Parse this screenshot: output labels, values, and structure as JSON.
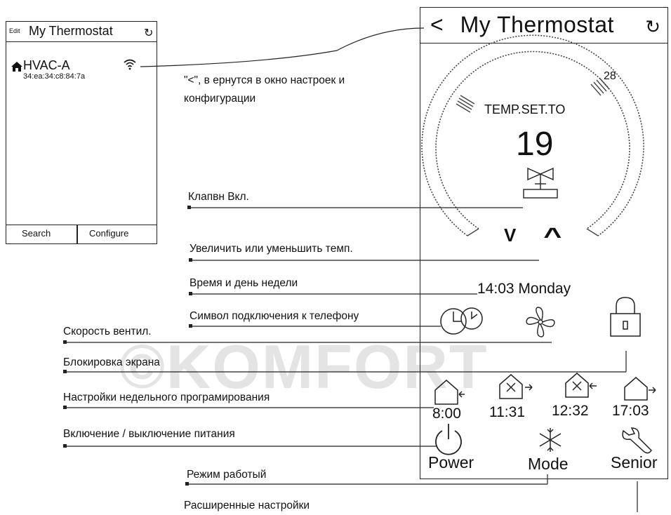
{
  "small_phone": {
    "edit": "Edit",
    "title": "My Thermostat",
    "refresh_icon": "refresh-icon",
    "device_name": "HVAC-A",
    "device_mac": "34:ea:34:c8:84:7a",
    "search": "Search",
    "configure": "Configure"
  },
  "back_note": "\"<\", в ернутся в окно настроек и конфигурации",
  "back_note_line1": "\"<\", в ернутся в окно настроек и",
  "back_note_line2": "конфигурации",
  "watermark": "©KOMFORT",
  "thermostat": {
    "back": "<",
    "title": "My Thermostat",
    "max_temp": "28",
    "set_label": "TEMP.SET.TO",
    "set_value": "19",
    "down": "V",
    "up": "^",
    "clock": "14:03 Monday",
    "schedule_times": [
      "8:00",
      "11:31",
      "12:32",
      "17:03"
    ],
    "power": "Power",
    "mode": "Mode",
    "senior": "Senior"
  },
  "annotations": {
    "valve": "Клапвн Вкл.",
    "temp": "Увеличить или уменьшить темп.",
    "time": "Время и день недели",
    "phone": "Символ подключения к телефону",
    "fan": "Скорость вентил.",
    "lock": "Блокировка экрана",
    "weekly": "Настройки недельного програмирования",
    "power": "Включение / выключение питания",
    "mode": "Режим работый",
    "advanced": "Расширенные настройки"
  }
}
